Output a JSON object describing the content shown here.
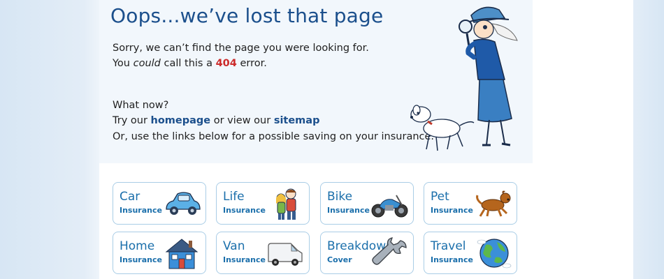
{
  "hero": {
    "title": "Oops...we’ve lost that page",
    "line1": "Sorry, we can’t find the page you were looking for.",
    "line2_prefix": "You ",
    "line2_em": "could",
    "line2_mid": " call this a ",
    "line2_code": "404",
    "line2_suffix": " error.",
    "what_now": "What now?",
    "try_prefix": "Try our ",
    "homepage_link": "homepage",
    "try_mid": " or view our ",
    "sitemap_link": "sitemap",
    "line5": "Or, use the links below for a possible saving on your insurance."
  },
  "cards": [
    {
      "name": "Car",
      "sub": "Insurance",
      "icon": "car-icon"
    },
    {
      "name": "Life",
      "sub": "Insurance",
      "icon": "family-icon"
    },
    {
      "name": "Bike",
      "sub": "Insurance",
      "icon": "motorbike-icon"
    },
    {
      "name": "Pet",
      "sub": "Insurance",
      "icon": "dog-icon"
    },
    {
      "name": "Home",
      "sub": "Insurance",
      "icon": "house-icon"
    },
    {
      "name": "Van",
      "sub": "Insurance",
      "icon": "van-icon"
    },
    {
      "name": "Breakdown",
      "sub": "Cover",
      "icon": "wrench-icon"
    },
    {
      "name": "Travel",
      "sub": "Insurance",
      "icon": "globe-icon"
    }
  ],
  "colors": {
    "brand": "#1b4f8c",
    "link": "#1b6fab",
    "error": "#cc2b2b",
    "card_border": "#a9cde6"
  }
}
